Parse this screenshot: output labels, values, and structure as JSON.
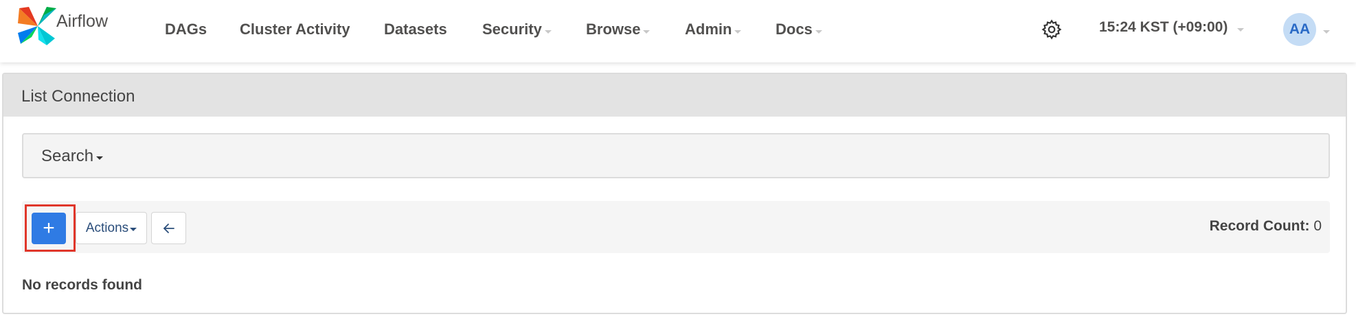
{
  "brand": {
    "name": "Airflow",
    "logo_icon": "airflow-pinwheel-icon"
  },
  "nav": {
    "items": [
      {
        "label": "DAGs",
        "dropdown": false
      },
      {
        "label": "Cluster Activity",
        "dropdown": false
      },
      {
        "label": "Datasets",
        "dropdown": false
      },
      {
        "label": "Security",
        "dropdown": true
      },
      {
        "label": "Browse",
        "dropdown": true
      },
      {
        "label": "Admin",
        "dropdown": true
      },
      {
        "label": "Docs",
        "dropdown": true
      }
    ],
    "settings_icon": "gear-icon",
    "timezone_label": "15:24 KST (+09:00)",
    "user_initials": "AA"
  },
  "page": {
    "title": "List Connection",
    "search_label": "Search",
    "toolbar": {
      "add_label": "+",
      "actions_label": "Actions",
      "back_icon": "arrow-left-icon",
      "record_count_label": "Record Count:",
      "record_count_value": "0"
    },
    "empty_message": "No records found"
  },
  "colors": {
    "primary_button": "#2f7be4",
    "highlight_border": "#e0362a",
    "avatar_bg": "#c4dcf5",
    "avatar_text": "#2a6ac6"
  }
}
